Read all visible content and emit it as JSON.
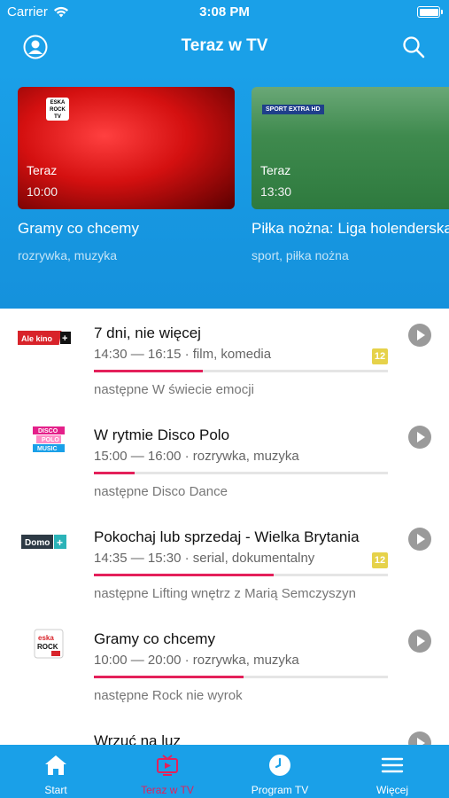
{
  "status_bar": {
    "carrier": "Carrier",
    "time": "3:08 PM"
  },
  "header": {
    "title": "Teraz w TV"
  },
  "featured": [
    {
      "channel_logo": "ESKA ROCK TV",
      "now": "Teraz",
      "time": "10:00",
      "title": "Gramy co chcemy",
      "category": "rozrywka, muzyka"
    },
    {
      "channel_logo": "SPORT EXTRA HD",
      "now": "Teraz",
      "time": "13:30",
      "title": "Piłka nożna: Liga holenderska",
      "category": "sport, piłka nożna"
    }
  ],
  "list": [
    {
      "channel": "Ale kino+ HD",
      "title": "7 dni, nie więcej",
      "meta": "14:30 — 16:15 · film, komedia",
      "progress": 0.37,
      "age": "12",
      "next": "następne W świecie emocji"
    },
    {
      "channel": "Disco Polo Music",
      "title": "W rytmie Disco Polo",
      "meta": "15:00 — 16:00 · rozrywka, muzyka",
      "progress": 0.14,
      "age": "",
      "next": "następne Disco Dance"
    },
    {
      "channel": "Domo+ HD",
      "title": "Pokochaj lub sprzedaj - Wielka Brytania",
      "meta": "14:35 — 15:30 · serial, dokumentalny",
      "progress": 0.61,
      "age": "12",
      "next": "następne Lifting wnętrz z Marią Semczyszyn"
    },
    {
      "channel": "ESKA ROCK TV",
      "title": "Gramy co chcemy",
      "meta": "10:00 — 20:00 · rozrywka, muzyka",
      "progress": 0.51,
      "age": "",
      "next": "następne Rock nie wyrok"
    },
    {
      "channel": "",
      "title": "Wrzuć na luz",
      "meta": "",
      "progress": 0,
      "age": "",
      "next": ""
    }
  ],
  "tabs": [
    {
      "label": "Start",
      "icon": "home-icon",
      "active": false
    },
    {
      "label": "Teraz w TV",
      "icon": "tv-icon",
      "active": true
    },
    {
      "label": "Program TV",
      "icon": "clock-icon",
      "active": false
    },
    {
      "label": "Więcej",
      "icon": "menu-icon",
      "active": false
    }
  ],
  "colors": {
    "brand_blue": "#1aa0e8",
    "accent_pink": "#e4205a",
    "age_badge": "#e6d24a"
  }
}
